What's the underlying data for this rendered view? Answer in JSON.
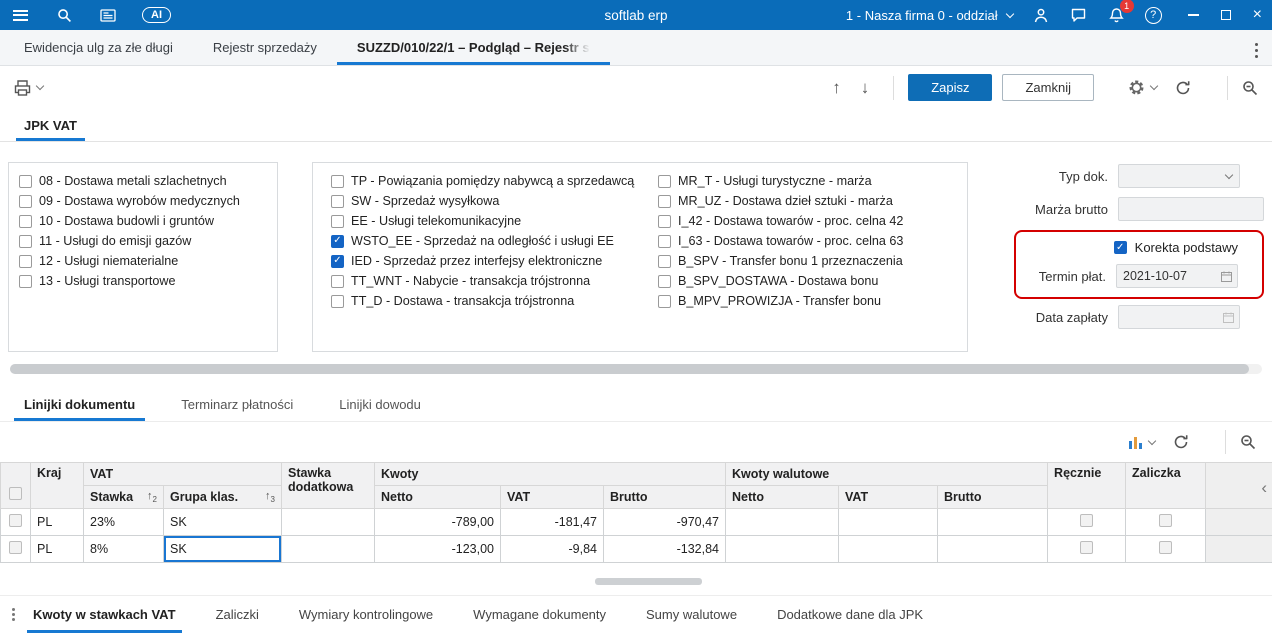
{
  "topbar": {
    "title": "softlab erp",
    "ai_label": "AI",
    "company_selector": "1 - Nasza firma 0 - oddział",
    "notification_count": "1"
  },
  "main_tabs": [
    {
      "label": "Ewidencja ulg za złe długi"
    },
    {
      "label": "Rejestr sprzedaży"
    },
    {
      "label": "SUZZD/010/22/1 – Podgląd – Rejestr s"
    }
  ],
  "toolbar": {
    "save": "Zapisz",
    "close": "Zamknij"
  },
  "form": {
    "tab": "JPK VAT",
    "group1": [
      {
        "label": "08 - Dostawa metali szlachetnych",
        "checked": false
      },
      {
        "label": "09 - Dostawa wyrobów medycznych",
        "checked": false
      },
      {
        "label": "10 - Dostawa budowli i gruntów",
        "checked": false
      },
      {
        "label": "11 - Usługi do emisji gazów",
        "checked": false
      },
      {
        "label": "12 - Usługi niematerialne",
        "checked": false
      },
      {
        "label": "13 - Usługi transportowe",
        "checked": false
      }
    ],
    "group2": [
      {
        "label": "TP - Powiązania pomiędzy nabywcą a sprzedawcą",
        "checked": false
      },
      {
        "label": "SW - Sprzedaż wysyłkowa",
        "checked": false
      },
      {
        "label": "EE - Usługi telekomunikacyjne",
        "checked": false
      },
      {
        "label": "WSTO_EE - Sprzedaż na odległość i usługi EE",
        "checked": true
      },
      {
        "label": "IED - Sprzedaż przez interfejsy elektroniczne",
        "checked": true
      },
      {
        "label": "TT_WNT - Nabycie - transakcja trójstronna",
        "checked": false
      },
      {
        "label": "TT_D - Dostawa - transakcja trójstronna",
        "checked": false
      }
    ],
    "group3": [
      {
        "label": "MR_T - Usługi turystyczne - marża",
        "checked": false
      },
      {
        "label": "MR_UZ - Dostawa dzieł sztuki - marża",
        "checked": false
      },
      {
        "label": "I_42 - Dostawa towarów - proc. celna 42",
        "checked": false
      },
      {
        "label": "I_63 - Dostawa towarów - proc. celna 63",
        "checked": false
      },
      {
        "label": "B_SPV - Transfer bonu 1 przeznaczenia",
        "checked": false
      },
      {
        "label": "B_SPV_DOSTAWA - Dostawa bonu",
        "checked": false
      },
      {
        "label": "B_MPV_PROWIZJA - Transfer bonu",
        "checked": false
      }
    ],
    "fields": {
      "typ_dok_label": "Typ dok.",
      "typ_dok_value": "",
      "marza_label": "Marża brutto",
      "marza_value": "",
      "korekta_label": "Korekta podstawy",
      "korekta_checked": true,
      "termin_label": "Termin płat.",
      "termin_value": "2021-10-07",
      "data_zaplaty_label": "Data zapłaty",
      "data_zaplaty_value": ""
    }
  },
  "detail_tabs": [
    {
      "label": "Linijki dokumentu"
    },
    {
      "label": "Terminarz płatności"
    },
    {
      "label": "Linijki dowodu"
    }
  ],
  "grid": {
    "group_headers": {
      "kraj": "Kraj",
      "vat": "VAT",
      "stawka_dodatkowa": "Stawka dodatkowa",
      "kwoty": "Kwoty",
      "kwoty_walutowe": "Kwoty walutowe",
      "recznie": "Ręcznie",
      "zaliczka": "Zaliczka"
    },
    "sub_headers": {
      "stawka": "Stawka",
      "stawka_sort": "2",
      "grupa": "Grupa klas.",
      "grupa_sort": "3",
      "netto": "Netto",
      "vat": "VAT",
      "brutto": "Brutto",
      "w_netto": "Netto",
      "w_vat": "VAT",
      "w_brutto": "Brutto"
    },
    "rows": [
      {
        "kraj": "PL",
        "stawka": "23%",
        "grupa": "SK",
        "stawka_dod": "",
        "netto": "-789,00",
        "vat": "-181,47",
        "brutto": "-970,47",
        "w_netto": "",
        "w_vat": "",
        "w_brutto": "",
        "recznie": false,
        "zaliczka": false
      },
      {
        "kraj": "PL",
        "stawka": "8%",
        "grupa": "SK",
        "stawka_dod": "",
        "netto": "-123,00",
        "vat": "-9,84",
        "brutto": "-132,84",
        "w_netto": "",
        "w_vat": "",
        "w_brutto": "",
        "recznie": false,
        "zaliczka": false
      }
    ]
  },
  "bottom_tabs": [
    {
      "label": "Kwoty w stawkach VAT"
    },
    {
      "label": "Zaliczki"
    },
    {
      "label": "Wymiary kontrolingowe"
    },
    {
      "label": "Wymagane dokumenty"
    },
    {
      "label": "Sumy walutowe"
    },
    {
      "label": "Dodatkowe dane dla JPK"
    }
  ],
  "colors": {
    "topbar": "#0a6cb9",
    "accent": "#1779d2",
    "save_button": "#0e6db6",
    "highlight_red": "#d40000",
    "cell_yellow": "#fafad6",
    "cell_blue": "#cadff2",
    "cell_gray": "#c4c8cb"
  }
}
